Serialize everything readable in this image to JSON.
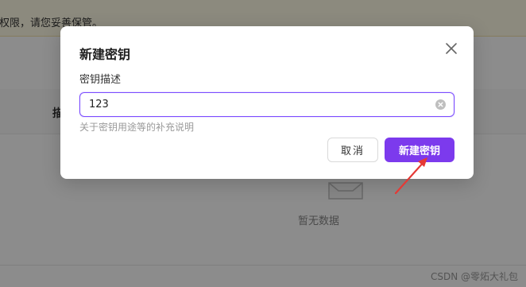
{
  "background": {
    "notice_text": "权限，请您妥善保管。",
    "table_header_fragment": "描",
    "empty_text": "暂无数据",
    "watermark": "CSDN @零炻大礼包"
  },
  "modal": {
    "title": "新建密钥",
    "field_label": "密钥描述",
    "input_value": "123",
    "help_text": "关于密钥用途等的补充说明",
    "cancel_label": "取消",
    "create_label": "新建密钥"
  },
  "colors": {
    "accent": "#7c3aed",
    "annotation_arrow": "#e53935",
    "notice_bg": "#fffbe6"
  },
  "icons": {
    "close": "close-icon",
    "clear": "clear-input-icon",
    "empty": "empty-box-icon"
  }
}
